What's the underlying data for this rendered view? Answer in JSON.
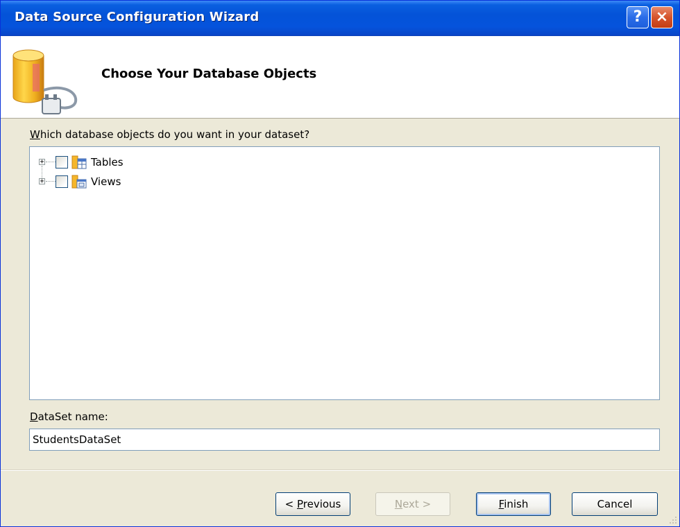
{
  "window": {
    "title": "Data Source Configuration Wizard",
    "help_glyph": "?",
    "close_glyph": "×"
  },
  "header": {
    "title": "Choose Your Database Objects",
    "icon": "database-plug-icon"
  },
  "prompt": "Which database objects do you want in your dataset?",
  "tree": {
    "nodes": [
      {
        "label": "Tables",
        "icon": "tables-folder-icon",
        "expanded": false,
        "checked": false
      },
      {
        "label": "Views",
        "icon": "views-folder-icon",
        "expanded": false,
        "checked": false
      }
    ],
    "expander_glyph": "+"
  },
  "dataset": {
    "label": "DataSet name:",
    "value": "StudentsDataSet"
  },
  "buttons": {
    "previous": "< Previous",
    "next": "Next >",
    "finish": "Finish",
    "cancel": "Cancel"
  },
  "colors": {
    "titlebar": "#0453d8",
    "dialog_bg": "#ece9d8",
    "input_border": "#7f9db9"
  }
}
